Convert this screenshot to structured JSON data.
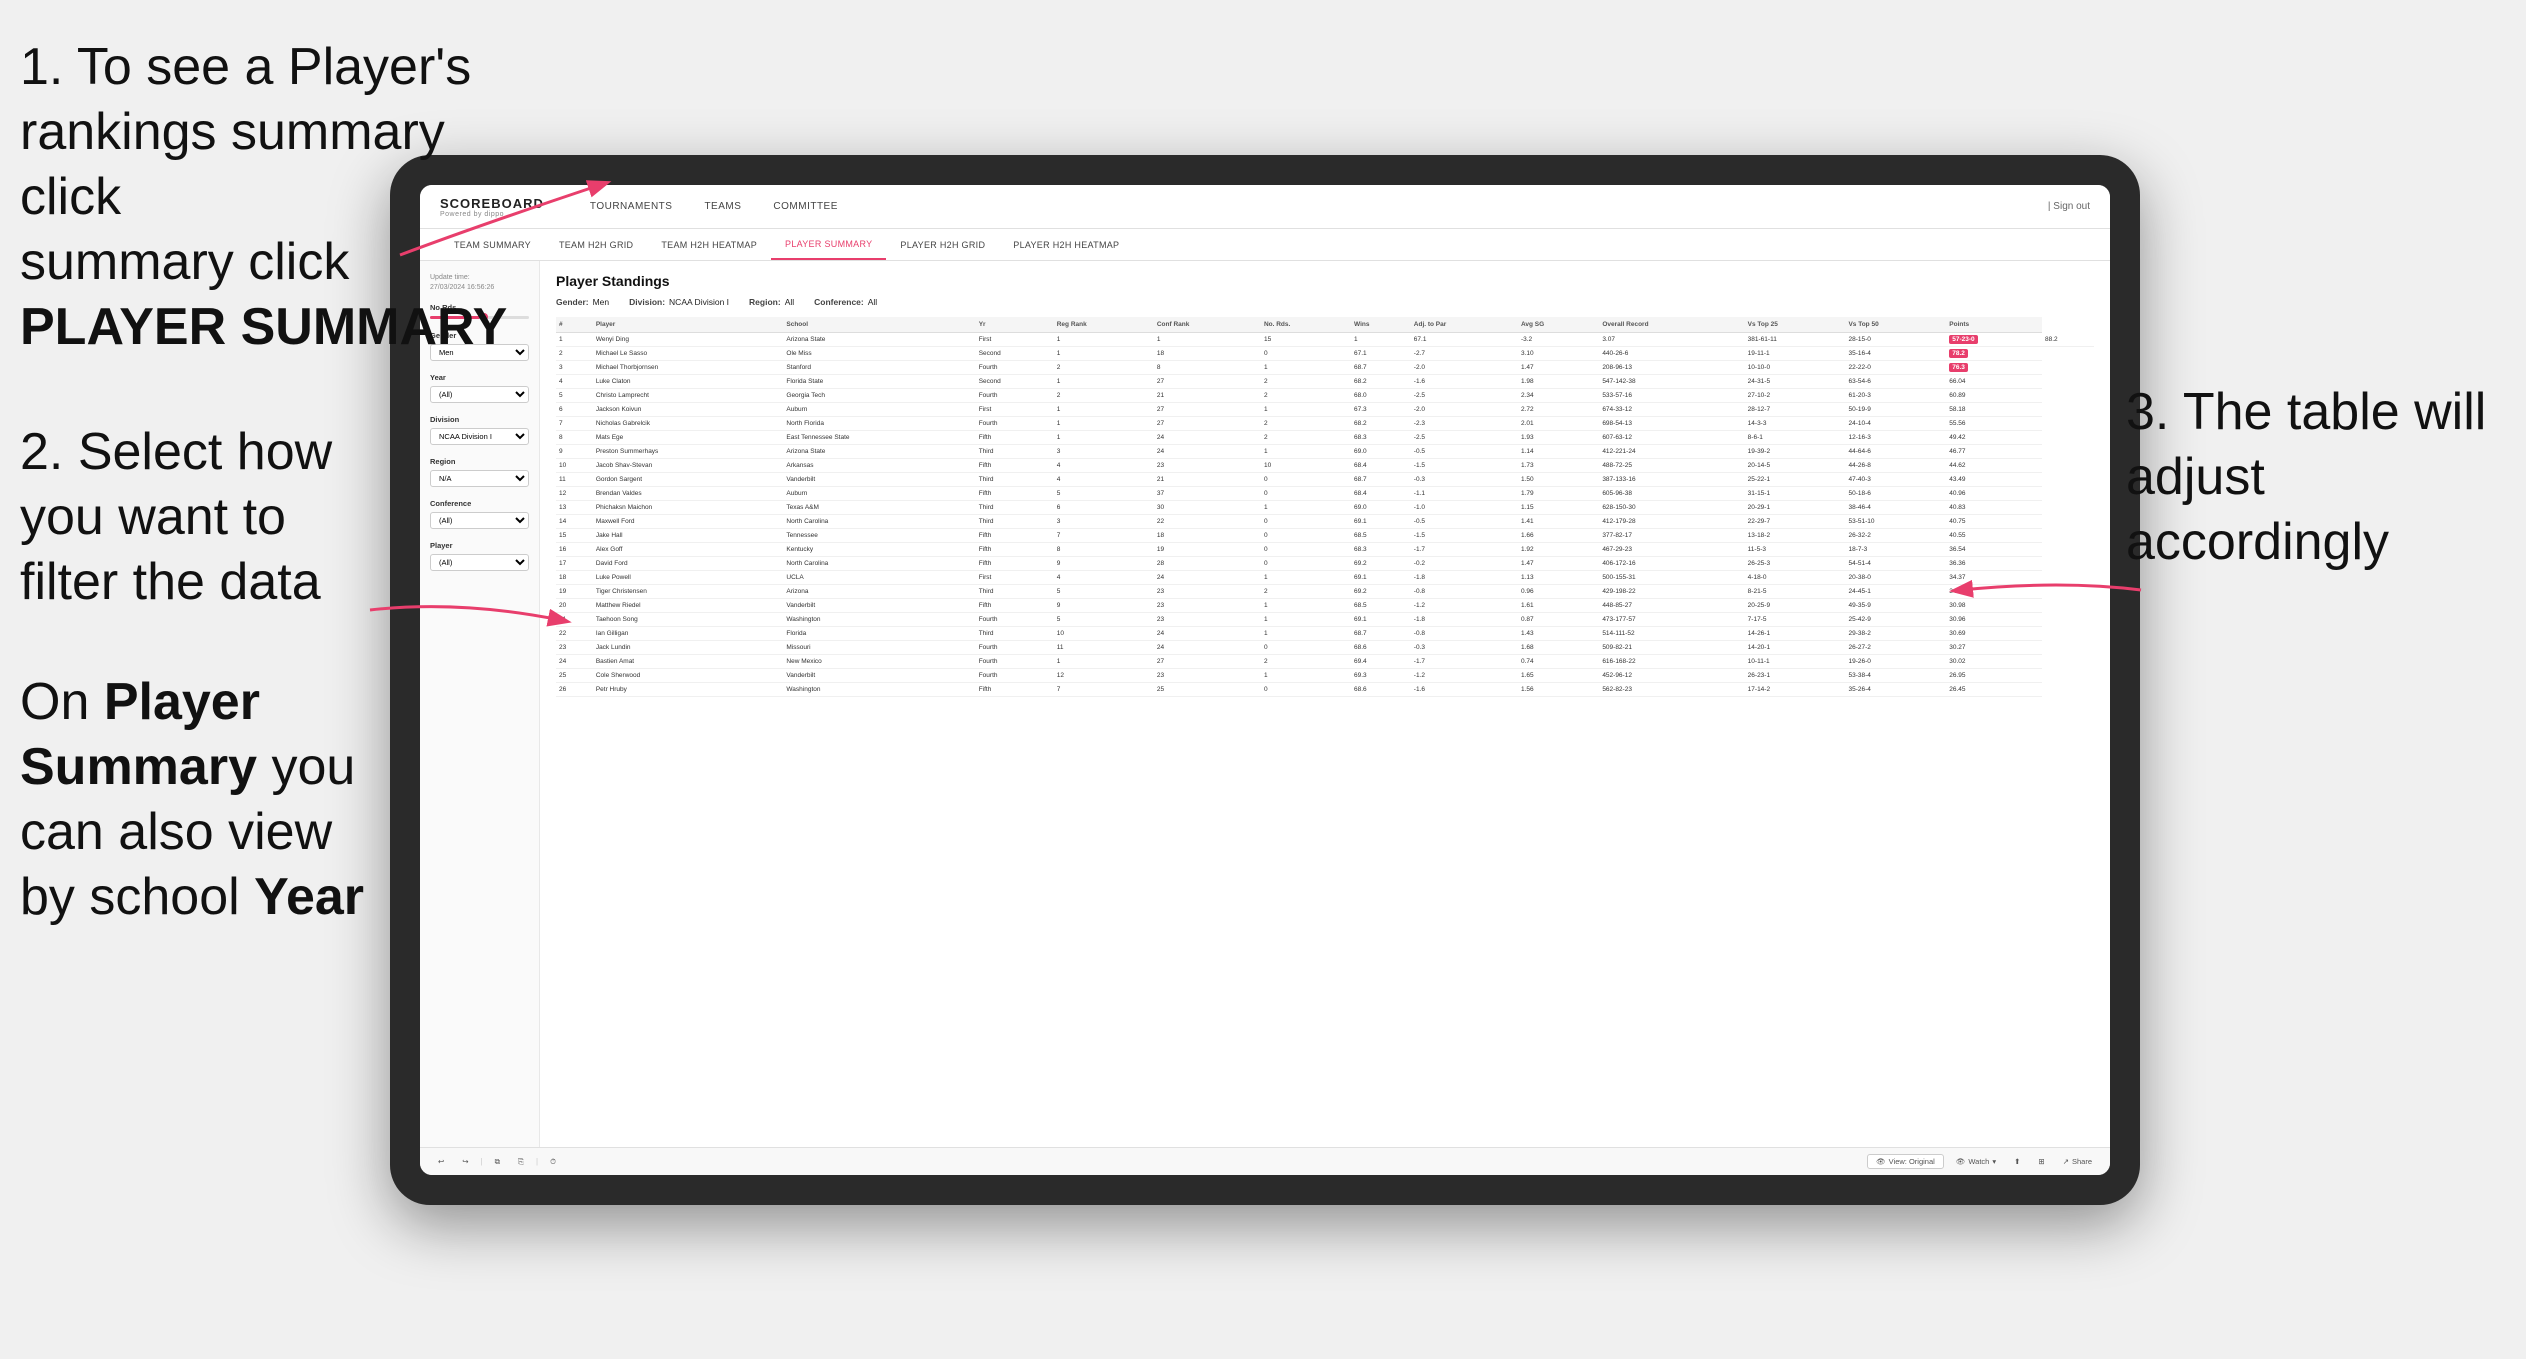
{
  "annotations": {
    "step1": "1. To see a Player's rankings summary click ",
    "step1_bold": "PLAYER SUMMARY",
    "step2_line1": "2. Select how",
    "step2_line2": "you want to",
    "step2_line3": "filter the data",
    "step3": "3. The table will adjust accordingly",
    "bottom_note_prefix": "On ",
    "bottom_note_bold1": "Player Summary",
    "bottom_note_mid": " you can also view by school ",
    "bottom_note_bold2": "Year"
  },
  "app": {
    "logo": "SCOREBOARD",
    "logo_sub": "Powered by dippo",
    "nav_items": [
      "TOURNAMENTS",
      "TEAMS",
      "COMMITTEE"
    ],
    "nav_right": [
      "| Sign out"
    ],
    "sub_nav": [
      {
        "label": "TEAM SUMMARY",
        "active": false
      },
      {
        "label": "TEAM H2H GRID",
        "active": false
      },
      {
        "label": "TEAM H2H HEATMAP",
        "active": false
      },
      {
        "label": "PLAYER SUMMARY",
        "active": true
      },
      {
        "label": "PLAYER H2H GRID",
        "active": false
      },
      {
        "label": "PLAYER H2H HEATMAP",
        "active": false
      }
    ]
  },
  "sidebar": {
    "update_label": "Update time:",
    "update_time": "27/03/2024 16:56:26",
    "no_rds_label": "No Rds.",
    "gender_label": "Gender",
    "gender_value": "Men",
    "year_label": "Year",
    "year_value": "(All)",
    "division_label": "Division",
    "division_value": "NCAA Division I",
    "region_label": "Region",
    "region_value": "N/A",
    "conference_label": "Conference",
    "conference_value": "(All)",
    "player_label": "Player",
    "player_value": "(All)"
  },
  "table": {
    "title": "Player Standings",
    "filters": {
      "gender_label": "Gender:",
      "gender_value": "Men",
      "division_label": "Division:",
      "division_value": "NCAA Division I",
      "region_label": "Region:",
      "region_value": "All",
      "conference_label": "Conference:",
      "conference_value": "All"
    },
    "columns": [
      "#",
      "Player",
      "School",
      "Yr",
      "Reg Rank",
      "Conf Rank",
      "No. Rds.",
      "Wins",
      "Adj. to Par",
      "Avg SG",
      "Overall Record",
      "Vs Top 25",
      "Vs Top 50",
      "Points"
    ],
    "rows": [
      [
        "1",
        "Wenyi Ding",
        "Arizona State",
        "First",
        "1",
        "1",
        "15",
        "1",
        "67.1",
        "-3.2",
        "3.07",
        "381-61-11",
        "28-15-0",
        "57-23-0",
        "88.2"
      ],
      [
        "2",
        "Michael Le Sasso",
        "Ole Miss",
        "Second",
        "1",
        "18",
        "0",
        "67.1",
        "-2.7",
        "3.10",
        "440-26-6",
        "19-11-1",
        "35-16-4",
        "78.2"
      ],
      [
        "3",
        "Michael Thorbjornsen",
        "Stanford",
        "Fourth",
        "2",
        "8",
        "1",
        "68.7",
        "-2.0",
        "1.47",
        "208-96-13",
        "10-10-0",
        "22-22-0",
        "76.3"
      ],
      [
        "4",
        "Luke Claton",
        "Florida State",
        "Second",
        "1",
        "27",
        "2",
        "68.2",
        "-1.6",
        "1.98",
        "547-142-38",
        "24-31-5",
        "63-54-6",
        "66.04"
      ],
      [
        "5",
        "Christo Lamprecht",
        "Georgia Tech",
        "Fourth",
        "2",
        "21",
        "2",
        "68.0",
        "-2.5",
        "2.34",
        "533-57-16",
        "27-10-2",
        "61-20-3",
        "60.89"
      ],
      [
        "6",
        "Jackson Koivun",
        "Auburn",
        "First",
        "1",
        "27",
        "1",
        "67.3",
        "-2.0",
        "2.72",
        "674-33-12",
        "28-12-7",
        "50-19-9",
        "58.18"
      ],
      [
        "7",
        "Nicholas Gabrelcik",
        "North Florida",
        "Fourth",
        "1",
        "27",
        "2",
        "68.2",
        "-2.3",
        "2.01",
        "698-54-13",
        "14-3-3",
        "24-10-4",
        "55.56"
      ],
      [
        "8",
        "Mats Ege",
        "East Tennessee State",
        "Fifth",
        "1",
        "24",
        "2",
        "68.3",
        "-2.5",
        "1.93",
        "607-63-12",
        "8-6-1",
        "12-16-3",
        "49.42"
      ],
      [
        "9",
        "Preston Summerhays",
        "Arizona State",
        "Third",
        "3",
        "24",
        "1",
        "69.0",
        "-0.5",
        "1.14",
        "412-221-24",
        "19-39-2",
        "44-64-6",
        "46.77"
      ],
      [
        "10",
        "Jacob Shav-Stevan",
        "Arkansas",
        "Fifth",
        "4",
        "23",
        "10",
        "68.4",
        "-1.5",
        "1.73",
        "488-72-25",
        "20-14-5",
        "44-26-8",
        "44.62"
      ],
      [
        "11",
        "Gordon Sargent",
        "Vanderbilt",
        "Third",
        "4",
        "21",
        "0",
        "68.7",
        "-0.3",
        "1.50",
        "387-133-16",
        "25-22-1",
        "47-40-3",
        "43.49"
      ],
      [
        "12",
        "Brendan Valdes",
        "Auburn",
        "Fifth",
        "5",
        "37",
        "0",
        "68.4",
        "-1.1",
        "1.79",
        "605-96-38",
        "31-15-1",
        "50-18-6",
        "40.96"
      ],
      [
        "13",
        "Phichaksn Maichon",
        "Texas A&M",
        "Third",
        "6",
        "30",
        "1",
        "69.0",
        "-1.0",
        "1.15",
        "628-150-30",
        "20-29-1",
        "38-46-4",
        "40.83"
      ],
      [
        "14",
        "Maxwell Ford",
        "North Carolina",
        "Third",
        "3",
        "22",
        "0",
        "69.1",
        "-0.5",
        "1.41",
        "412-179-28",
        "22-29-7",
        "53-51-10",
        "40.75"
      ],
      [
        "15",
        "Jake Hall",
        "Tennessee",
        "Fifth",
        "7",
        "18",
        "0",
        "68.5",
        "-1.5",
        "1.66",
        "377-82-17",
        "13-18-2",
        "26-32-2",
        "40.55"
      ],
      [
        "16",
        "Alex Goff",
        "Kentucky",
        "Fifth",
        "8",
        "19",
        "0",
        "68.3",
        "-1.7",
        "1.92",
        "467-29-23",
        "11-5-3",
        "18-7-3",
        "36.54"
      ],
      [
        "17",
        "David Ford",
        "North Carolina",
        "Fifth",
        "9",
        "28",
        "0",
        "69.2",
        "-0.2",
        "1.47",
        "406-172-16",
        "26-25-3",
        "54-51-4",
        "36.36"
      ],
      [
        "18",
        "Luke Powell",
        "UCLA",
        "First",
        "4",
        "24",
        "1",
        "69.1",
        "-1.8",
        "1.13",
        "500-155-31",
        "4-18-0",
        "20-38-0",
        "34.37"
      ],
      [
        "19",
        "Tiger Christensen",
        "Arizona",
        "Third",
        "5",
        "23",
        "2",
        "69.2",
        "-0.8",
        "0.96",
        "429-198-22",
        "8-21-5",
        "24-45-1",
        "34.31"
      ],
      [
        "20",
        "Matthew Riedel",
        "Vanderbilt",
        "Fifth",
        "9",
        "23",
        "1",
        "68.5",
        "-1.2",
        "1.61",
        "448-85-27",
        "20-25-9",
        "49-35-9",
        "30.98"
      ],
      [
        "21",
        "Taehoon Song",
        "Washington",
        "Fourth",
        "5",
        "23",
        "1",
        "69.1",
        "-1.8",
        "0.87",
        "473-177-57",
        "7-17-5",
        "25-42-9",
        "30.96"
      ],
      [
        "22",
        "Ian Gilligan",
        "Florida",
        "Third",
        "10",
        "24",
        "1",
        "68.7",
        "-0.8",
        "1.43",
        "514-111-52",
        "14-26-1",
        "29-38-2",
        "30.69"
      ],
      [
        "23",
        "Jack Lundin",
        "Missouri",
        "Fourth",
        "11",
        "24",
        "0",
        "68.6",
        "-0.3",
        "1.68",
        "509-82-21",
        "14-20-1",
        "26-27-2",
        "30.27"
      ],
      [
        "24",
        "Bastien Amat",
        "New Mexico",
        "Fourth",
        "1",
        "27",
        "2",
        "69.4",
        "-1.7",
        "0.74",
        "616-168-22",
        "10-11-1",
        "19-26-0",
        "30.02"
      ],
      [
        "25",
        "Cole Sherwood",
        "Vanderbilt",
        "Fourth",
        "12",
        "23",
        "1",
        "69.3",
        "-1.2",
        "1.65",
        "452-96-12",
        "26-23-1",
        "53-38-4",
        "26.95"
      ],
      [
        "26",
        "Petr Hruby",
        "Washington",
        "Fifth",
        "7",
        "25",
        "0",
        "68.6",
        "-1.6",
        "1.56",
        "562-82-23",
        "17-14-2",
        "35-26-4",
        "26.45"
      ]
    ]
  },
  "toolbar": {
    "view_label": "View: Original",
    "watch_label": "Watch",
    "share_label": "Share"
  }
}
